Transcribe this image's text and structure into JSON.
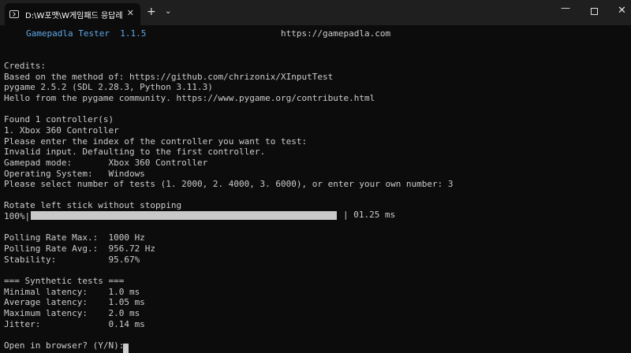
{
  "window": {
    "tab_title": "D:\\W포맷\\W게임패드 응답레이트",
    "tab_close": "✕",
    "new_tab": "+",
    "dropdown": "⌄",
    "minimize": "—",
    "close": "✕"
  },
  "terminal": {
    "app_name": "Gamepadla Tester",
    "version": "1.1.5",
    "url": "https://gamepadla.com",
    "credits_heading": "Credits:",
    "credits_based": "Based on the method of: https://github.com/chrizonix/XInputTest",
    "pygame_version": "pygame 2.5.2 (SDL 2.28.3, Python 3.11.3)",
    "pygame_hello": "Hello from the pygame community. https://www.pygame.org/contribute.html",
    "found": "Found 1 controller(s)",
    "controller_1": "1. Xbox 360 Controller",
    "prompt_index": "Please enter the index of the controller you want to test:",
    "invalid_input": "Invalid input. Defaulting to the first controller.",
    "gamepad_mode": "Gamepad mode:       Xbox 360 Controller",
    "os": "Operating System:   Windows",
    "prompt_tests": "Please select number of tests (1. 2000, 2. 4000, 3. 6000), or enter your own number: 3",
    "rotate": "Rotate left stick without stopping",
    "progress_label": "100%|",
    "progress_value": 1.0,
    "progress_end": "| 01.25 ms",
    "polling_max": "Polling Rate Max.:  1000 Hz",
    "polling_avg": "Polling Rate Avg.:  956.72 Hz",
    "stability": "Stability:          95.67%",
    "synthetic_heading": "=== Synthetic tests ===",
    "min_latency": "Minimal latency:    1.0 ms",
    "avg_latency": "Average latency:    1.05 ms",
    "max_latency": "Maximum latency:    2.0 ms",
    "jitter": "Jitter:             0.14 ms",
    "open_browser": "Open in browser? (Y/N):"
  }
}
